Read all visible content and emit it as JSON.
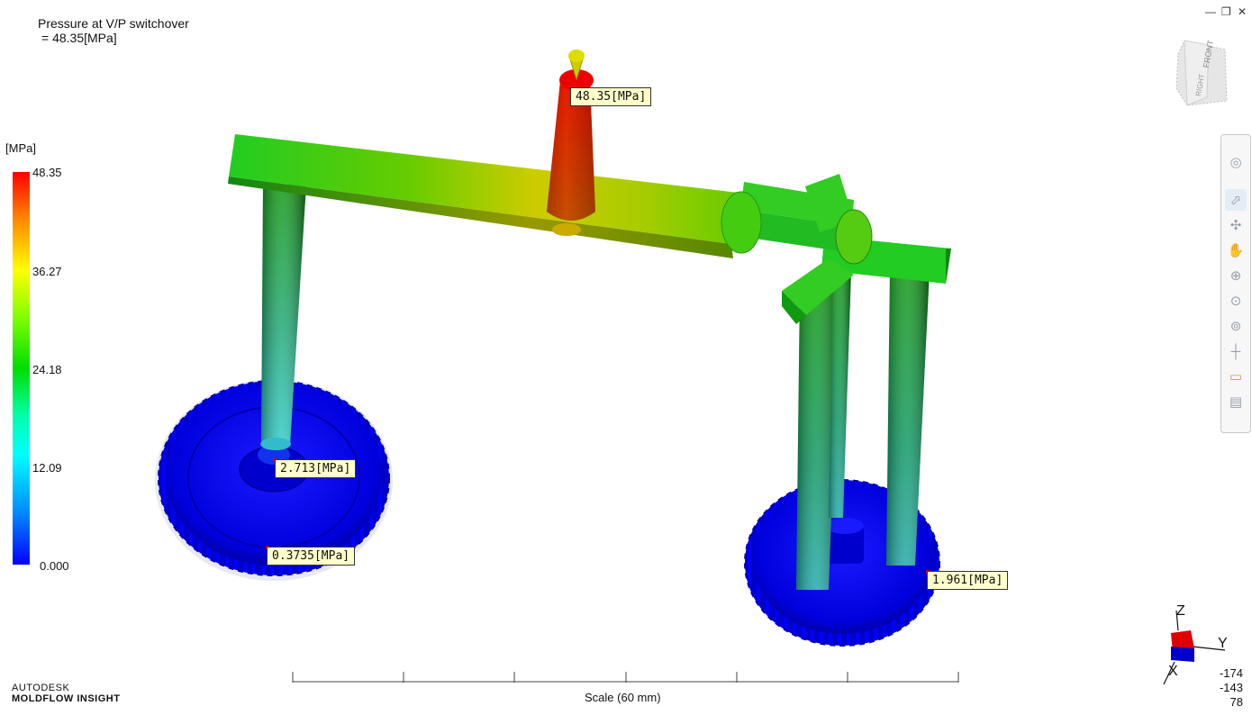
{
  "result": {
    "title": "Pressure at V/P switchover",
    "value_line": " = 48.35[MPa]"
  },
  "legend": {
    "unit": "[MPa]",
    "ticks": [
      "48.35",
      "36.27",
      "24.18",
      "12.09",
      "0.000"
    ],
    "colors": {
      "max": "#ff0000",
      "mid": "#00dd00",
      "min": "#0000ff"
    }
  },
  "probes": [
    {
      "label": "48.35[MPa]"
    },
    {
      "label": "2.713[MPa]"
    },
    {
      "label": "0.3735[MPa]"
    },
    {
      "label": "1.961[MPa]"
    }
  ],
  "window_controls": {
    "minimize": "—",
    "restore": "❐",
    "close": "✕"
  },
  "viewcube": {
    "face_front": "FRONT",
    "face_right": "RIGHT"
  },
  "nav_tools": [
    "steering-wheel",
    "select",
    "orbit",
    "pan",
    "zoom-region",
    "zoom",
    "zoom-extents",
    "center",
    "measure",
    "snapshot"
  ],
  "scale": {
    "label": "Scale (60 mm)"
  },
  "triad": {
    "z": "Z",
    "y": "Y",
    "x": "X"
  },
  "coords": {
    "x": "-174",
    "y": "-143",
    "z": "78"
  },
  "brand": {
    "company": "AUTODESK",
    "product": "MOLDFLOW INSIGHT"
  }
}
